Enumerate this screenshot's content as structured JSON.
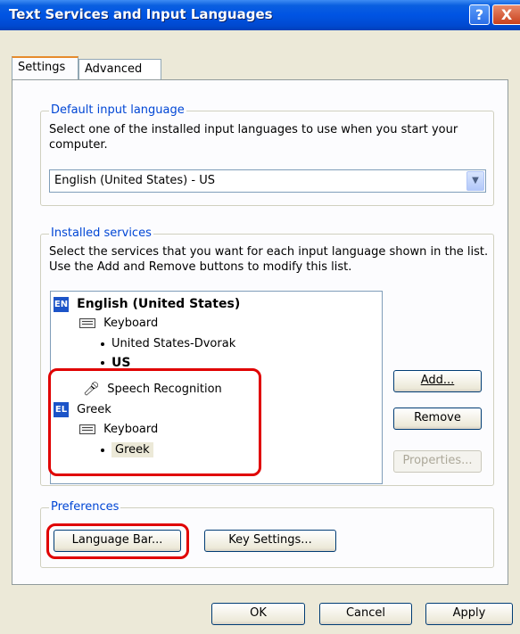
{
  "window": {
    "title": "Text Services and Input Languages",
    "help_glyph": "?",
    "close_glyph": "X"
  },
  "tabs": [
    {
      "label": "Settings",
      "selected": true
    },
    {
      "label": "Advanced",
      "selected": false
    }
  ],
  "default_language": {
    "legend": "Default input language",
    "description": "Select one of the installed input languages to use when you start your computer.",
    "selected_value": "English (United States) - US"
  },
  "installed_services": {
    "legend": "Installed services",
    "description": "Select the services that you want for each input language shown in the list. Use the Add and Remove buttons to modify this list.",
    "tree": {
      "english": {
        "badge": "EN",
        "badge_color": "#1c54c8",
        "label": "English (United States)"
      },
      "english_keyboard": "Keyboard",
      "english_layouts": [
        "United States-Dvorak",
        "US"
      ],
      "speech": "Speech Recognition",
      "greek": {
        "badge": "EL",
        "badge_color": "#1c54c8",
        "label": "Greek"
      },
      "greek_keyboard": "Keyboard",
      "greek_layouts": [
        "Greek"
      ]
    },
    "buttons": {
      "add": "Add...",
      "remove": "Remove",
      "properties": "Properties..."
    }
  },
  "preferences": {
    "legend": "Preferences",
    "language_bar": "Language Bar...",
    "key_settings": "Key Settings..."
  },
  "footer": {
    "ok": "OK",
    "cancel": "Cancel",
    "apply": "Apply"
  },
  "highlight_color": "#e00000"
}
